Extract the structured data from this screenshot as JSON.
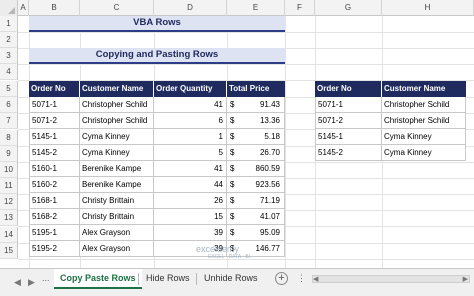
{
  "columns": [
    "A",
    "B",
    "C",
    "D",
    "E",
    "F",
    "G",
    "H"
  ],
  "rows": [
    "1",
    "2",
    "3",
    "4",
    "5",
    "6",
    "7",
    "8",
    "9",
    "10",
    "11",
    "12",
    "13",
    "14",
    "15"
  ],
  "title_banner": "VBA Rows",
  "subtitle_banner": "Copying and Pasting Rows",
  "main_table": {
    "headers": [
      "Order No",
      "Customer Name",
      "Order Quantity",
      "Total Price"
    ],
    "rows": [
      {
        "order": "5071-1",
        "name": "Christopher Schild",
        "qty": "41",
        "cur": "$",
        "price": "91.43"
      },
      {
        "order": "5071-2",
        "name": "Christopher Schild",
        "qty": "6",
        "cur": "$",
        "price": "13.36"
      },
      {
        "order": "5145-1",
        "name": "Cyma Kinney",
        "qty": "1",
        "cur": "$",
        "price": "5.18"
      },
      {
        "order": "5145-2",
        "name": "Cyma Kinney",
        "qty": "5",
        "cur": "$",
        "price": "26.70"
      },
      {
        "order": "5160-1",
        "name": "Berenike Kampe",
        "qty": "41",
        "cur": "$",
        "price": "860.59"
      },
      {
        "order": "5160-2",
        "name": "Berenike Kampe",
        "qty": "44",
        "cur": "$",
        "price": "923.56"
      },
      {
        "order": "5168-1",
        "name": "Christy Brittain",
        "qty": "26",
        "cur": "$",
        "price": "71.19"
      },
      {
        "order": "5168-2",
        "name": "Christy Brittain",
        "qty": "15",
        "cur": "$",
        "price": "41.07"
      },
      {
        "order": "5195-1",
        "name": "Alex Grayson",
        "qty": "39",
        "cur": "$",
        "price": "95.09"
      },
      {
        "order": "5195-2",
        "name": "Alex Grayson",
        "qty": "39",
        "cur": "$",
        "price": "146.77"
      }
    ]
  },
  "paste_table": {
    "headers": [
      "Order No",
      "Customer Name"
    ],
    "rows": [
      {
        "order": "5071-1",
        "name": "Christopher Schild"
      },
      {
        "order": "5071-2",
        "name": "Christopher Schild"
      },
      {
        "order": "5145-1",
        "name": "Cyma Kinney"
      },
      {
        "order": "5145-2",
        "name": "Cyma Kinney"
      }
    ]
  },
  "tabs": {
    "nav_prev": "◀",
    "nav_next": "▶",
    "more_left": "...",
    "items": [
      "Copy Paste Rows",
      "Hide Rows",
      "Unhide Rows"
    ],
    "add_label": "+",
    "more_right": "⋮"
  },
  "watermark": "exceldemy",
  "watermark_sub": "EXCEL · DATA · BI",
  "colors": {
    "header_fill": "#1f2a5e",
    "banner_fill": "#dde3f3",
    "active_tab": "#1e7145"
  }
}
